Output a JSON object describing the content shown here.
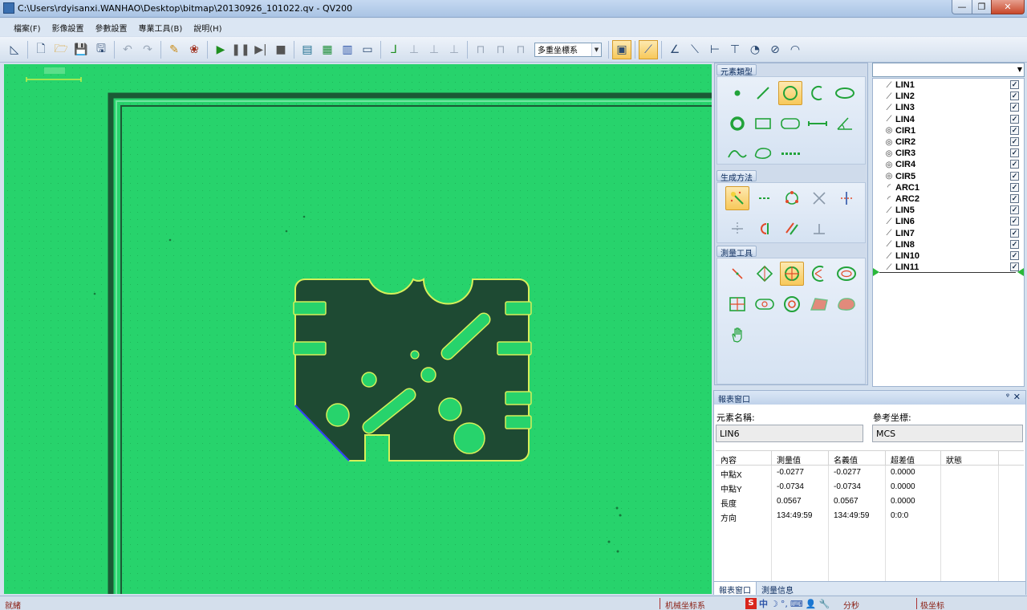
{
  "window": {
    "title": "C:\\Users\\rdyisanxi.WANHAO\\Desktop\\bitmap\\20130926_101022.qv - QV200"
  },
  "menu": [
    "檔案(F)",
    "影像設置",
    "參數設置",
    "專業工具(B)",
    "說明(H)"
  ],
  "toolbar": {
    "coord_combo": "多重坐標系"
  },
  "palette": {
    "element_types_title": "元素類型",
    "generate_title": "生成方法",
    "measure_title": "測量工具"
  },
  "element_list": {
    "items": [
      {
        "name": "LIN1",
        "type": "line"
      },
      {
        "name": "LIN2",
        "type": "line"
      },
      {
        "name": "LIN3",
        "type": "line"
      },
      {
        "name": "LIN4",
        "type": "line"
      },
      {
        "name": "CIR1",
        "type": "circle"
      },
      {
        "name": "CIR2",
        "type": "circle"
      },
      {
        "name": "CIR3",
        "type": "circle"
      },
      {
        "name": "CIR4",
        "type": "circle"
      },
      {
        "name": "CIR5",
        "type": "circle"
      },
      {
        "name": "ARC1",
        "type": "arc"
      },
      {
        "name": "ARC2",
        "type": "arc"
      },
      {
        "name": "LIN5",
        "type": "line"
      },
      {
        "name": "LIN6",
        "type": "line"
      },
      {
        "name": "LIN7",
        "type": "line"
      },
      {
        "name": "LIN8",
        "type": "line"
      },
      {
        "name": "LIN10",
        "type": "line"
      },
      {
        "name": "LIN11",
        "type": "line"
      }
    ]
  },
  "report": {
    "title": "報表窗口",
    "element_name_label": "元素名稱:",
    "element_name_value": "LIN6",
    "ref_coord_label": "參考坐標:",
    "ref_coord_value": "MCS",
    "columns": [
      "內容",
      "測量值",
      "名義值",
      "超差值",
      "狀態"
    ],
    "rows": [
      [
        "中點X",
        "-0.0277",
        "-0.0277",
        "0.0000",
        ""
      ],
      [
        "中點Y",
        "-0.0734",
        "-0.0734",
        "0.0000",
        ""
      ],
      [
        "長度",
        "0.0567",
        "0.0567",
        "0.0000",
        ""
      ],
      [
        "方向",
        "134:49:59",
        "134:49:59",
        "0:0:0",
        ""
      ]
    ],
    "tabs": [
      "報表窗口",
      "測量信息"
    ]
  },
  "status": {
    "ready": "就緒",
    "machine_coord": "机械坐标系",
    "ime_char": "中",
    "seconds": "分秒",
    "polar": "极坐标"
  },
  "colors": {
    "camera_bg": "#27d36c",
    "part": "#1e4a33",
    "highlight": "#f7c85a"
  }
}
